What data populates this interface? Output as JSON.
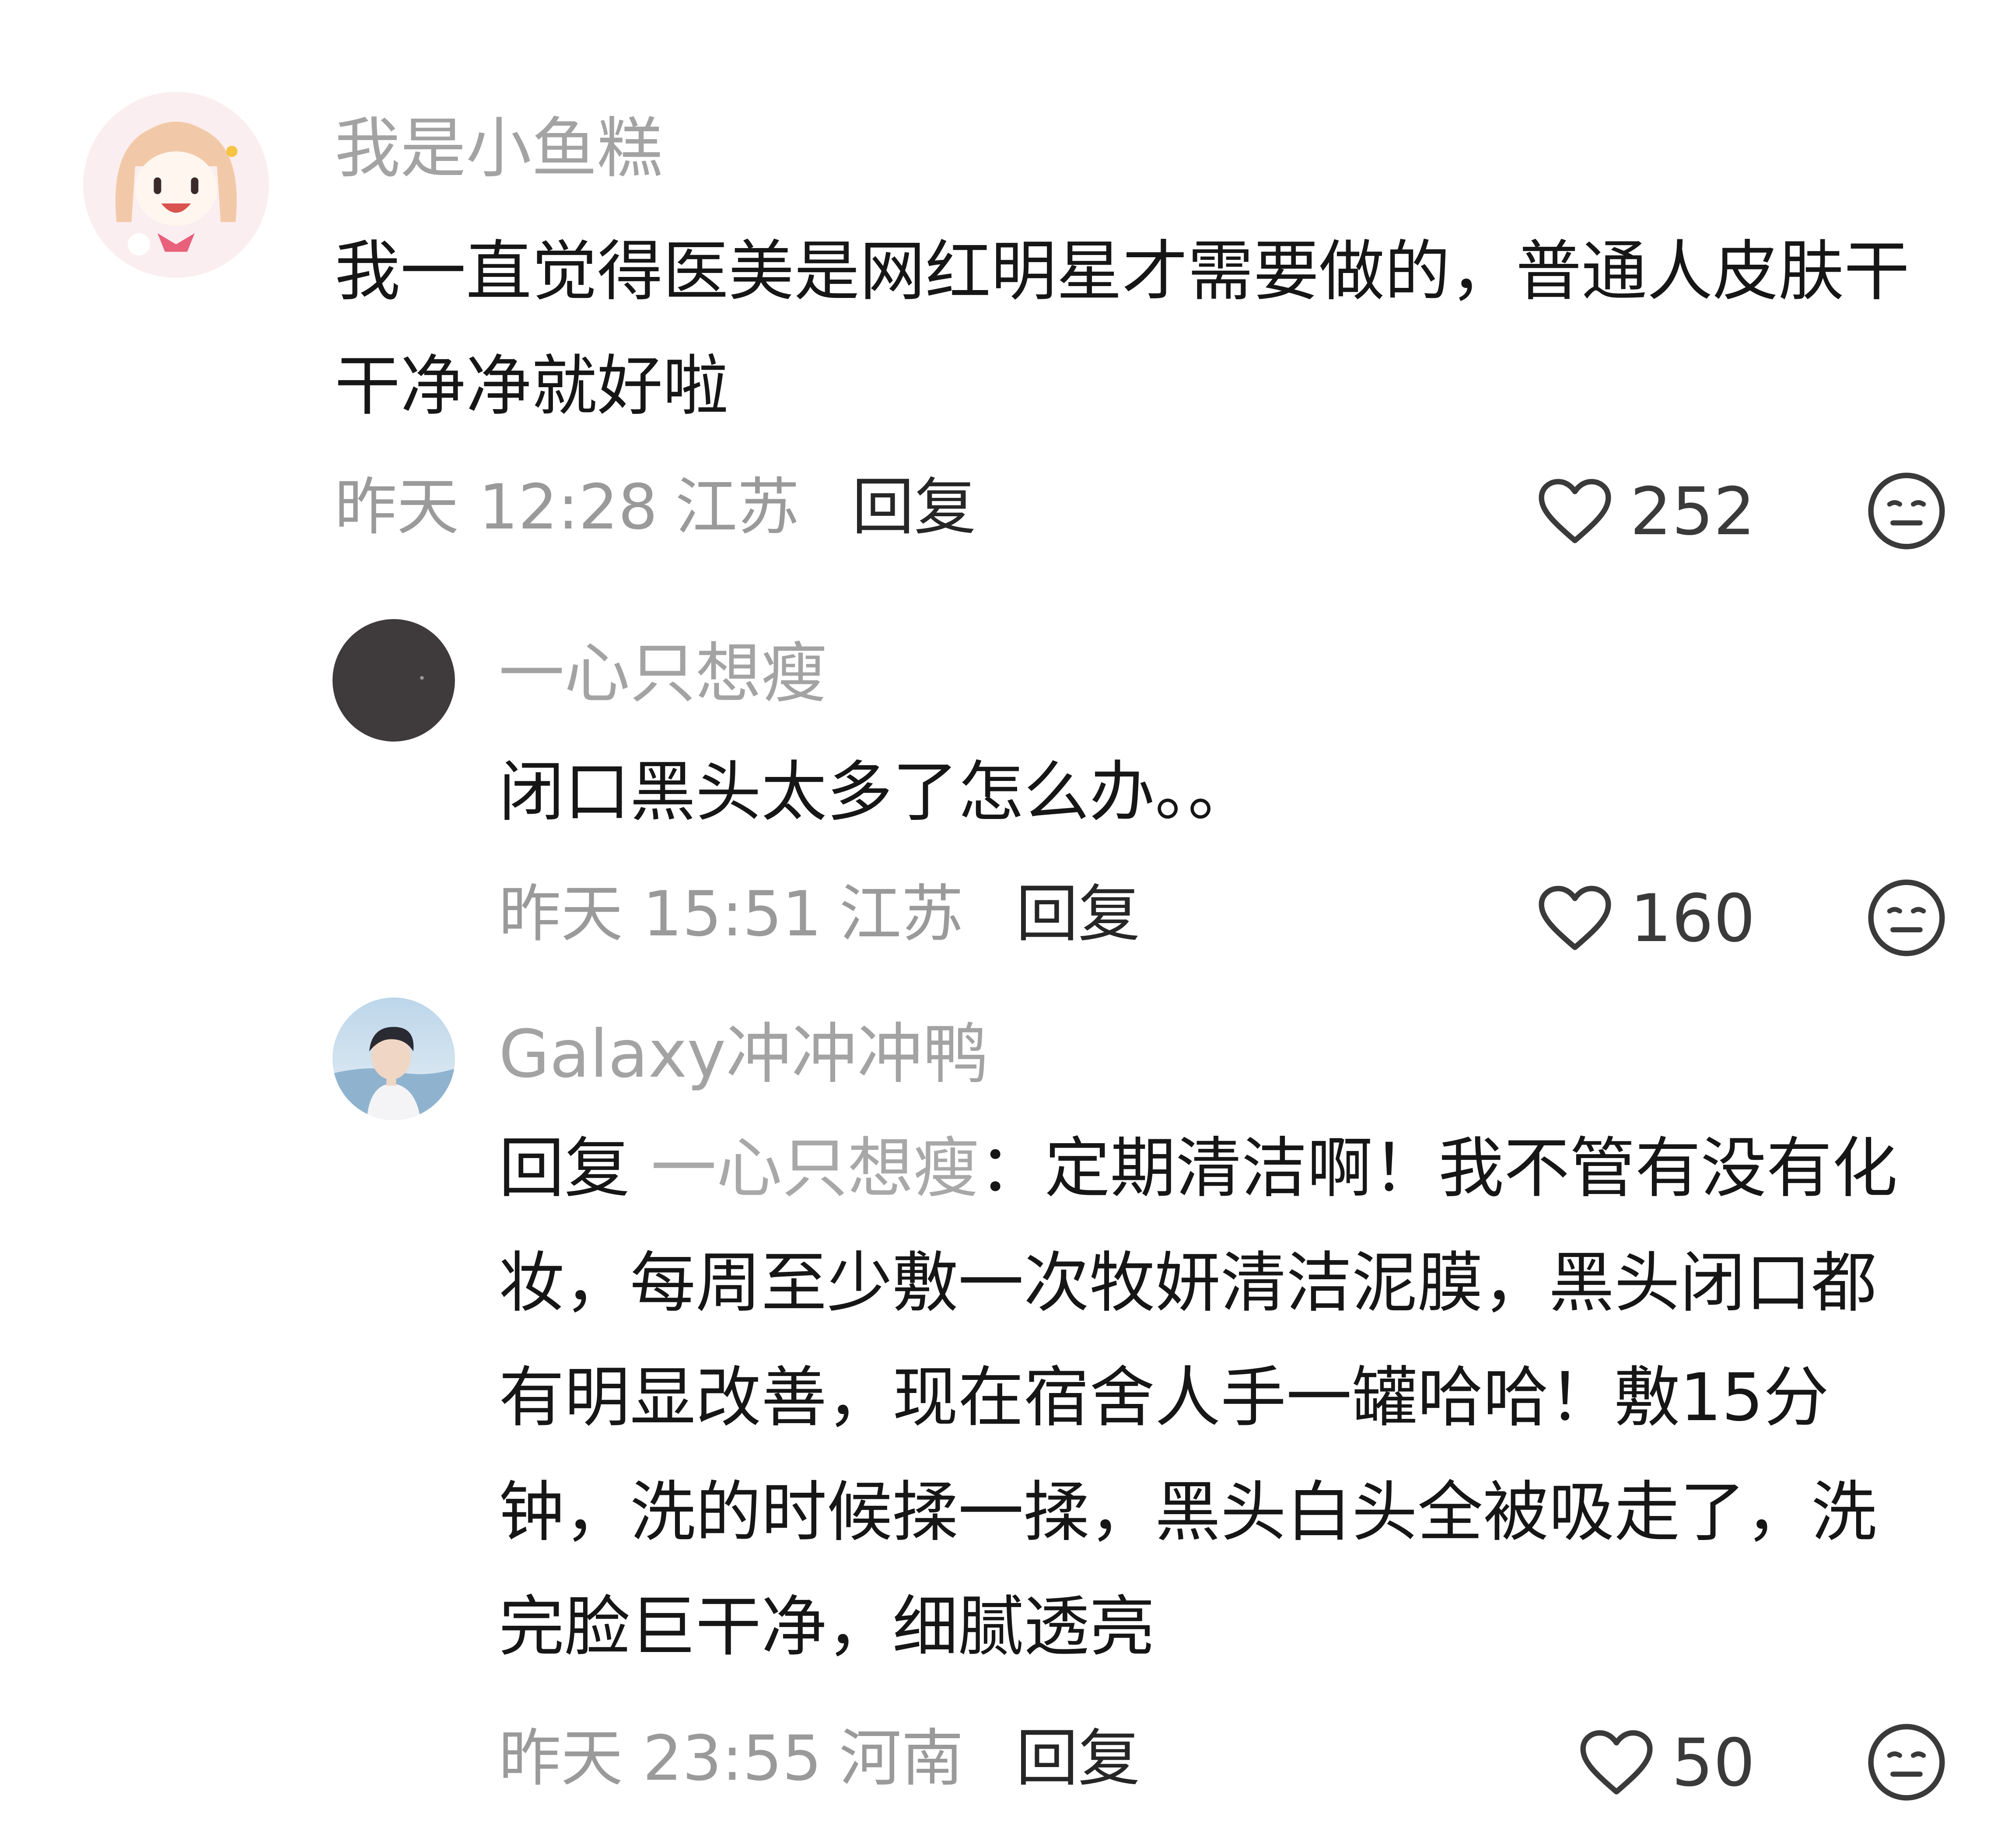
{
  "comments": [
    {
      "username": "我是小鱼糕",
      "text": "我一直觉得医美是网红明星才需要做的，普通人皮肤干干净净就好啦",
      "time": "昨天 12:28",
      "location": "江苏",
      "reply_label": "回复",
      "likes": "252",
      "avatar_icon": "anime-girl-avatar"
    },
    {
      "username": "一心只想瘦",
      "text": "闭口黑头太多了怎么办。。",
      "time": "昨天 15:51",
      "location": "江苏",
      "reply_label": "回复",
      "likes": "160",
      "avatar_icon": "dark-circle-avatar"
    },
    {
      "username": "Galaxy冲冲冲鸭",
      "reply_prefix": "回复",
      "reply_target": "一心只想瘦",
      "text": "：定期清洁啊！我不管有没有化妆，每周至少敷一次牧妍清洁泥膜，黑头闭口都有明显改善，现在宿舍人手一罐哈哈！敷15分钟，洗的时候揉一揉，黑头白头全被吸走了，洗完脸巨干净，细腻透亮",
      "time": "昨天 23:55",
      "location": "河南",
      "reply_label": "回复",
      "likes": "50",
      "avatar_icon": "boy-photo-avatar"
    }
  ],
  "icons": {
    "like": "heart-outline-icon",
    "dislike": "meh-face-icon"
  },
  "colors": {
    "text": "#161616",
    "username": "#a3a3a3",
    "meta": "#9a9a9a",
    "icon": "#3a3a3a"
  }
}
